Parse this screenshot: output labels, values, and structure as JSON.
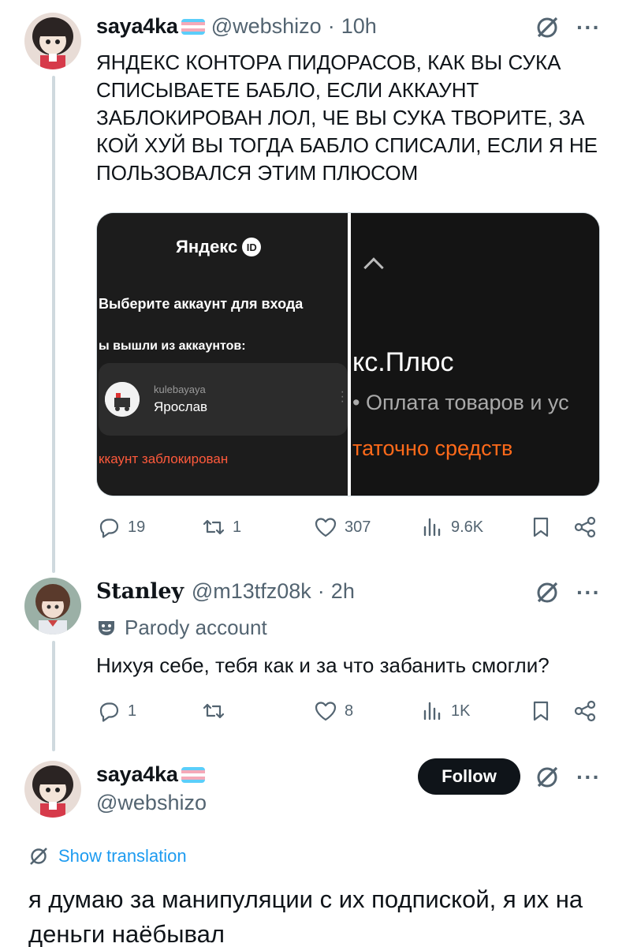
{
  "tweet1": {
    "name": "saya4ka",
    "handle": "@webshizo",
    "time": "10h",
    "separator": "·",
    "text": "ЯНДЕКС КОНТОРА ПИДОРАСОВ, КАК ВЫ СУКА СПИСЫВАЕТЕ БАБЛО, ЕСЛИ АККАУНТ ЗАБЛОКИРОВАН ЛОЛ, ЧЕ ВЫ СУКА ТВОРИТЕ, ЗА КОЙ ХУЙ ВЫ ТОГДА БАБЛО СПИСАЛИ, ЕСЛИ Я НЕ ПОЛЬЗОВАЛСЯ ЭТИМ ПЛЮСОМ",
    "media": {
      "left": {
        "brand": "Яндекс",
        "badge": "ID",
        "choose": "Выберите аккаунт для входа",
        "logged_out": "ы вышли из аккаунтов:",
        "account_login": "kulebayaya",
        "account_name": "Ярослав",
        "blocked": "ккаунт заблокирован"
      },
      "right": {
        "title": "кс.Плюс",
        "subtitle": "• Оплата товаров и ус",
        "error": "таточно средств"
      }
    },
    "stats": {
      "replies": "19",
      "retweets": "1",
      "likes": "307",
      "views": "9.6K"
    }
  },
  "tweet2": {
    "name": "Stanley",
    "handle": "@m13tfz08k",
    "time": "2h",
    "separator": "·",
    "label": "Parody account",
    "text": "Нихуя себе, тебя как и за что забанить смогли?",
    "stats": {
      "replies": "1",
      "retweets": "",
      "likes": "8",
      "views": "1K"
    }
  },
  "tweet3": {
    "name": "saya4ka",
    "handle": "@webshizo",
    "follow_label": "Follow",
    "show_translation": "Show translation",
    "text": "я думаю за манипуляции с их подпиской, я их на деньги наёбывал"
  },
  "icons": {
    "reply": "reply-icon",
    "retweet": "retweet-icon",
    "like": "heart-icon",
    "views": "views-icon",
    "bookmark": "bookmark-icon",
    "share": "share-icon",
    "grok": "grok-icon",
    "more": "more-icon",
    "parody": "parody-mask-icon",
    "translate": "translate-icon",
    "flag": "trans-flag-icon"
  },
  "colors": {
    "accent": "#1d9bf0",
    "text": "#0f1419",
    "muted": "#536471",
    "error": "#ff5a3c",
    "orange": "#ff6a1a"
  },
  "more_glyph": "···"
}
